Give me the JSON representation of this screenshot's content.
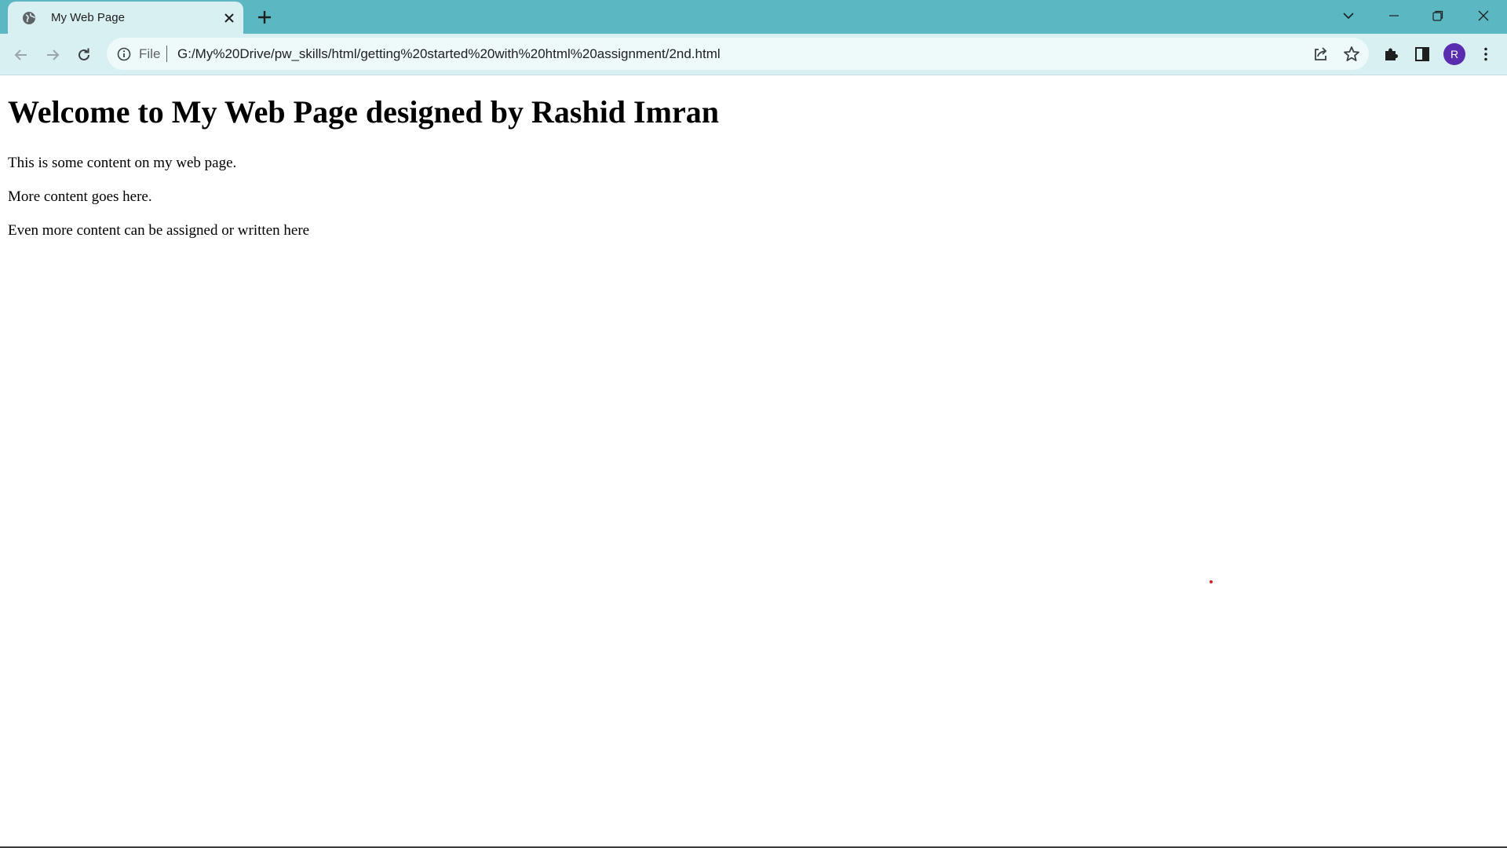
{
  "browser": {
    "tab": {
      "title": "My Web Page",
      "favicon": "globe-icon"
    },
    "toolbar": {
      "scheme_label": "File",
      "url": "G:/My%20Drive/pw_skills/html/getting%20started%20with%20html%20assignment/2nd.html",
      "profile_initial": "R"
    },
    "colors": {
      "titlebar": "#5bb7c1",
      "toolbar": "#d8f0f2",
      "avatar": "#5a2db0"
    }
  },
  "page": {
    "heading": "Welcome to My Web Page designed by Rashid Imran",
    "paragraphs": [
      "This is some content on my web page.",
      "More content goes here.",
      "Even more content can be assigned or written here"
    ]
  }
}
